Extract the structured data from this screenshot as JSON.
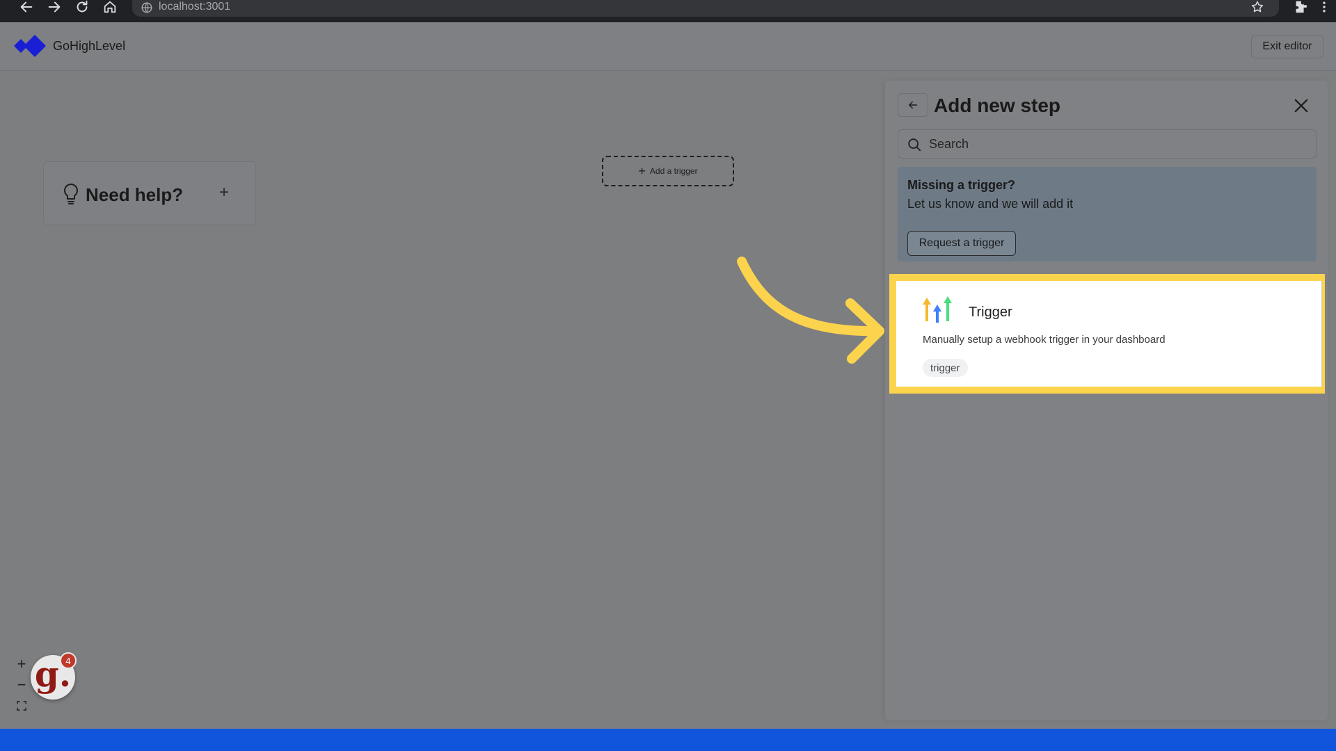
{
  "browser": {
    "url": "localhost:3001"
  },
  "header": {
    "brand": "GoHighLevel",
    "exit_label": "Exit editor"
  },
  "canvas": {
    "help_title": "Need help?",
    "help_plus": "+",
    "add_trigger_label": "Add a trigger",
    "zoom_in": "+",
    "zoom_out": "−",
    "widget_letter": "g.",
    "widget_badge": "4"
  },
  "panel": {
    "title": "Add new step",
    "search_placeholder": "Search",
    "missing_title": "Missing a trigger?",
    "missing_text": "Let us know and we will add it",
    "request_label": "Request a trigger",
    "trigger": {
      "title": "Trigger",
      "description": "Manually setup a webhook trigger in your dashboard",
      "tag": "trigger"
    }
  },
  "colors": {
    "highlight": "#fcd34d",
    "brand_blue": "#1a1fd6",
    "bottom_bar": "#1155dd",
    "badge": "#c0392b"
  }
}
